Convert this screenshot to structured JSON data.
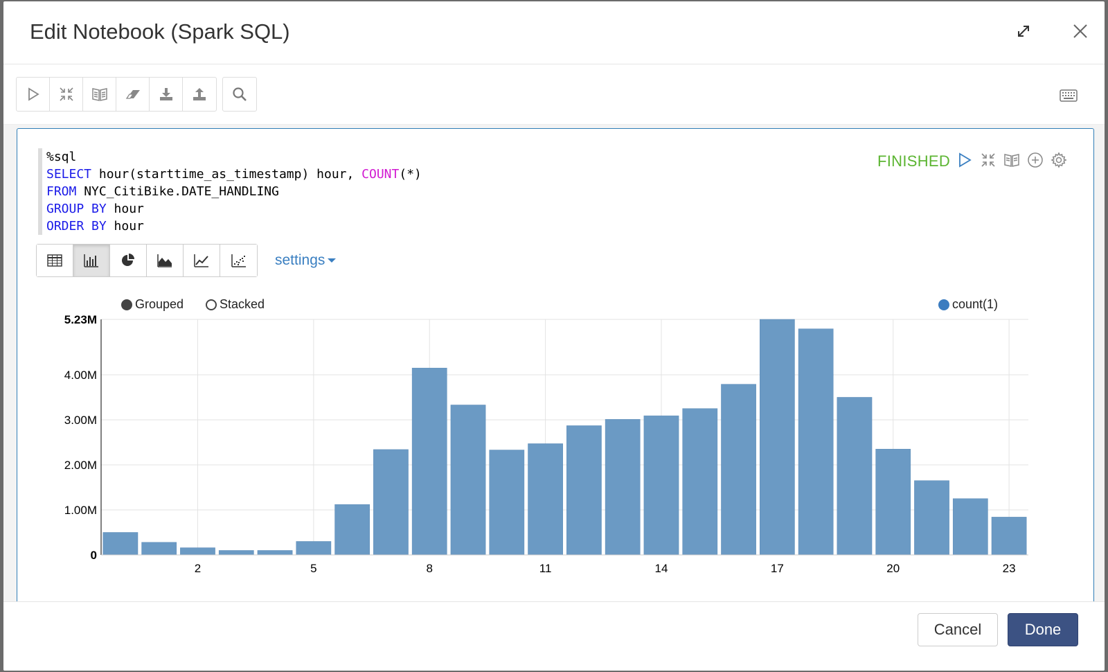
{
  "modal": {
    "title": "Edit Notebook (Spark SQL)"
  },
  "paragraph": {
    "code_lines": [
      [
        {
          "t": "%sql",
          "c": ""
        }
      ],
      [
        {
          "t": "SELECT",
          "c": "kw"
        },
        {
          "t": " hour(starttime_as_timestamp) hour, ",
          "c": ""
        },
        {
          "t": "COUNT",
          "c": "fn"
        },
        {
          "t": "(*)",
          "c": ""
        }
      ],
      [
        {
          "t": "FROM",
          "c": "kw"
        },
        {
          "t": " NYC_CitiBike.DATE_HANDLING",
          "c": ""
        }
      ],
      [
        {
          "t": "GROUP BY",
          "c": "kw"
        },
        {
          "t": " hour",
          "c": ""
        }
      ],
      [
        {
          "t": "ORDER BY",
          "c": "kw"
        },
        {
          "t": " hour",
          "c": ""
        }
      ]
    ],
    "status": "FINISHED",
    "settings_label": "settings"
  },
  "chart_controls": {
    "grouped_label": "Grouped",
    "stacked_label": "Stacked",
    "mode": "Grouped"
  },
  "footer": {
    "cancel_label": "Cancel",
    "done_label": "Done"
  },
  "colors": {
    "bar": "#6b9ac4",
    "legend_dot": "#3b7cc0",
    "finished": "#5cb532",
    "done_button": "#3c5283"
  },
  "chart_data": {
    "type": "bar",
    "legend": [
      "count(1)"
    ],
    "legend_position": "top-right",
    "grid": true,
    "x": [
      0,
      1,
      2,
      3,
      4,
      5,
      6,
      7,
      8,
      9,
      10,
      11,
      12,
      13,
      14,
      15,
      16,
      17,
      18,
      19,
      20,
      21,
      22,
      23
    ],
    "x_tick_labels": [
      "2",
      "5",
      "8",
      "11",
      "14",
      "17",
      "20",
      "23"
    ],
    "x_ticks": [
      2,
      5,
      8,
      11,
      14,
      17,
      20,
      23
    ],
    "series": [
      {
        "name": "count(1)",
        "values": [
          500000,
          280000,
          160000,
          100000,
          100000,
          300000,
          1120000,
          2340000,
          4150000,
          3330000,
          2330000,
          2470000,
          2870000,
          3010000,
          3090000,
          3250000,
          3790000,
          5230000,
          5020000,
          3500000,
          2350000,
          1650000,
          1250000,
          840000
        ]
      }
    ],
    "y_ticks": [
      0,
      1000000,
      2000000,
      3000000,
      4000000,
      5230000
    ],
    "y_tick_labels": [
      "0",
      "1.00M",
      "2.00M",
      "3.00M",
      "4.00M",
      "5.23M"
    ],
    "ylim": [
      0,
      5230000
    ]
  }
}
